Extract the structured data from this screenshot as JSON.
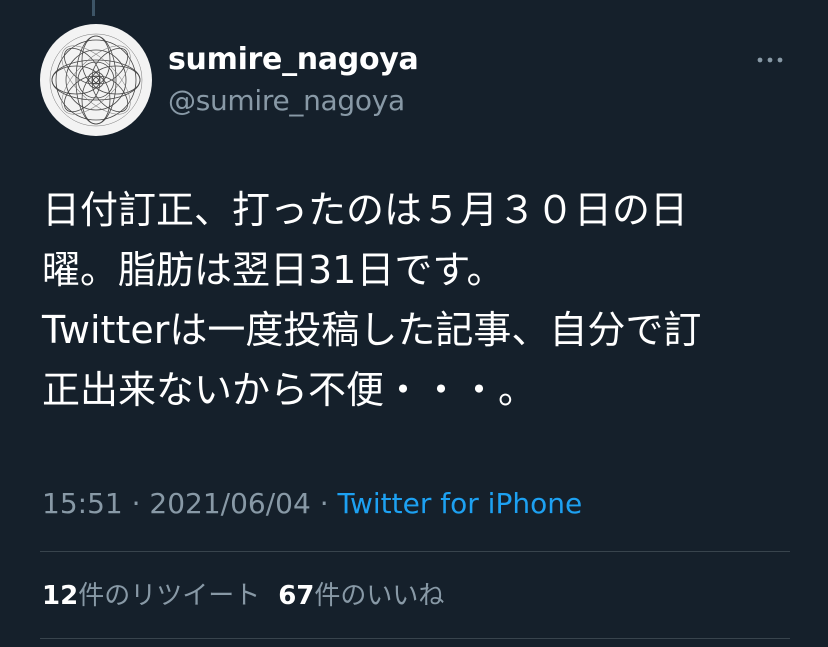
{
  "tweet": {
    "author": {
      "display_name": "sumire_nagoya",
      "handle": "@sumire_nagoya"
    },
    "text_lines": [
      "日付訂正、打ったのは５月３０日の日",
      "曜。脂肪は翌日31日です。",
      "Twitterは一度投稿した記事、自分で訂",
      "正出来ないから不便・・・。"
    ],
    "time": "15:51",
    "separator": "·",
    "date": "2021/06/04",
    "source": "Twitter for iPhone",
    "retweets": {
      "count": "12",
      "label": "件のリツイート"
    },
    "likes": {
      "count": "67",
      "label": "件のいいね"
    }
  },
  "icons": {
    "more": "more-horizontal-icon"
  },
  "colors": {
    "background": "#15202b",
    "primary_text": "#ffffff",
    "secondary_text": "#8899a6",
    "accent": "#1da1f2",
    "divider": "#38444d"
  }
}
